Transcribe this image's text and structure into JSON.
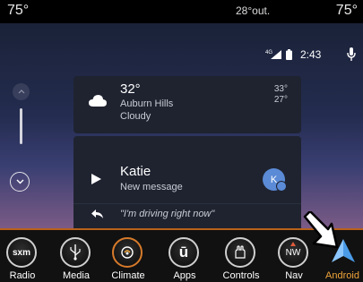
{
  "status_bar": {
    "temp_left": "75°",
    "outside_temp": "28°",
    "outside_label": "out.",
    "temp_right": "75°"
  },
  "android_auto": {
    "network": "4G",
    "time": "2:43",
    "weather": {
      "temp": "32°",
      "place": "Auburn Hills",
      "condition": "Cloudy",
      "high": "33°",
      "low": "27°"
    },
    "message": {
      "sender": "Katie",
      "subtitle": "New message",
      "avatar_letter": "K",
      "reply": "\"I'm driving right now\""
    }
  },
  "bottom_bar": {
    "items": [
      {
        "label": "Radio",
        "icon": "sxm-icon",
        "icon_text": "sxm"
      },
      {
        "label": "Media",
        "icon": "usb-icon"
      },
      {
        "label": "Climate",
        "icon": "climate-icon"
      },
      {
        "label": "Apps",
        "icon": "apps-icon",
        "icon_text": "ū"
      },
      {
        "label": "Controls",
        "icon": "controls-icon"
      },
      {
        "label": "Nav",
        "icon": "compass-icon",
        "icon_text": "NW"
      },
      {
        "label": "Android",
        "icon": "android-auto-icon"
      }
    ]
  },
  "colors": {
    "accent_orange": "#b8621a",
    "android_label": "#f0a43a",
    "android_blue": "#4a9be8",
    "card_bg": "#1f2330"
  }
}
